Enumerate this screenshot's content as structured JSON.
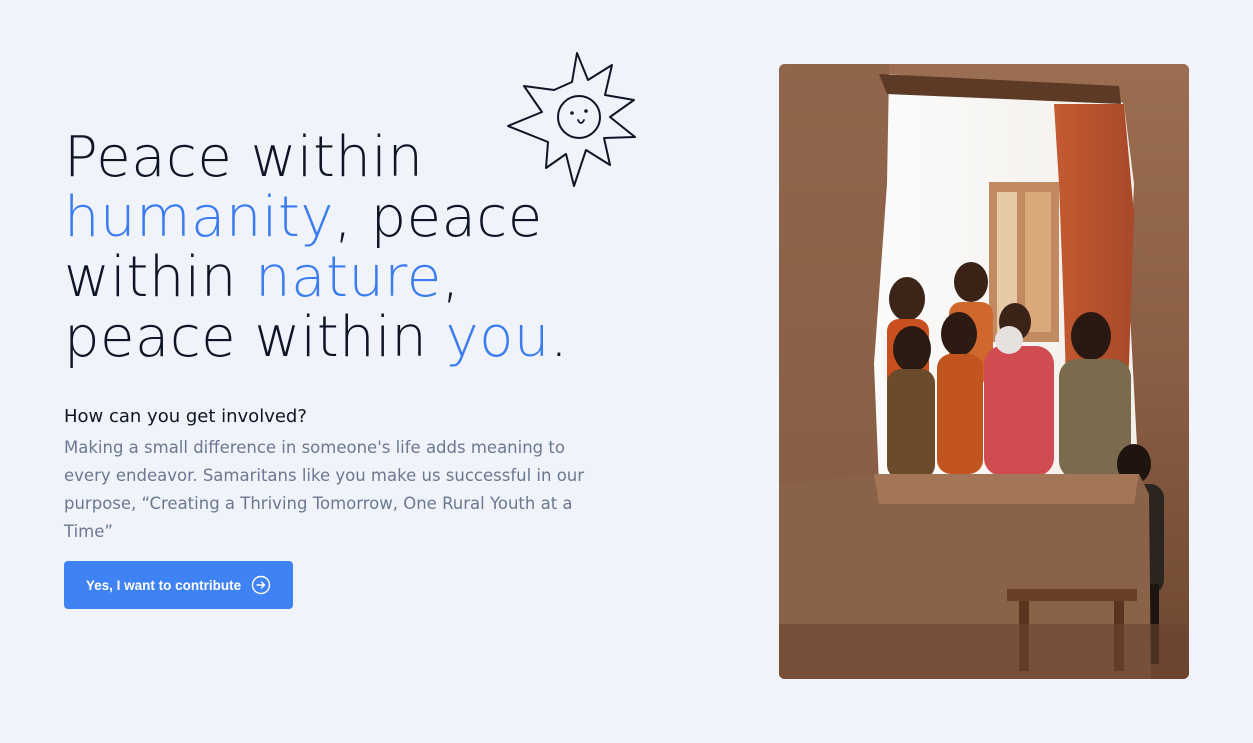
{
  "headline": {
    "line1": "Peace within",
    "accent1": "humanity",
    "line2_rest": ", peace",
    "line3_start": "within ",
    "accent2": "nature",
    "line3_end": ",",
    "line4_start": "peace within ",
    "accent3": "you",
    "line4_end": "."
  },
  "involved": {
    "heading": "How can you get involved?",
    "body": "Making a small difference in someone's life adds meaning to every endeavor. Samaritans like you make us successful in our purpose, “Creating a Thriving Tomorrow, One Rural Youth at a Time”"
  },
  "cta": {
    "label": "Yes, I want to contribute",
    "icon": "arrow-right-circle-icon"
  },
  "decorations": {
    "sun_icon": "smiling-sun-doodle-icon"
  },
  "photo": {
    "subject": "children-in-window-photo"
  },
  "colors": {
    "background": "#f0f3f9",
    "text": "#0d1526",
    "accent": "#3b7cf0",
    "muted": "#6b7891",
    "button": "#3f82f4"
  }
}
